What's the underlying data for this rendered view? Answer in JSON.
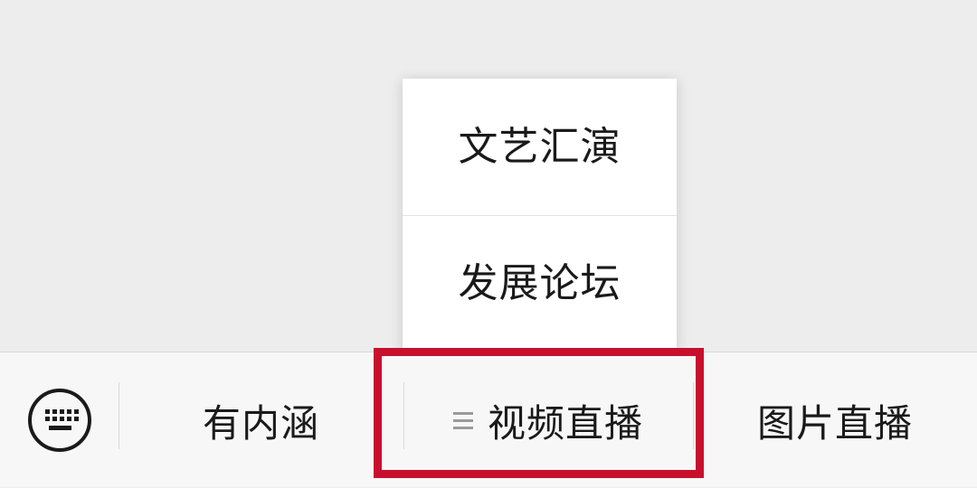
{
  "submenu": {
    "items": [
      {
        "label": "文艺汇演"
      },
      {
        "label": "发展论坛"
      }
    ]
  },
  "menubar": {
    "keyboard_icon": "keyboard-icon",
    "tabs": [
      {
        "label": "有内涵"
      },
      {
        "label": "视频直播",
        "icon": "list-icon"
      },
      {
        "label": "图片直播"
      }
    ]
  },
  "colors": {
    "highlight": "#c8102e",
    "background": "#ededed",
    "menubar": "#f7f7f7"
  }
}
